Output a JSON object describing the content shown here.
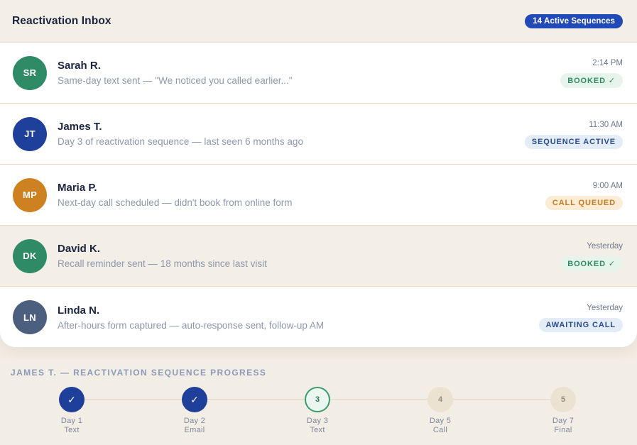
{
  "inbox": {
    "title": "Reactivation Inbox",
    "badge": "14 Active Sequences",
    "rows": [
      {
        "initials": "SR",
        "name": "Sarah R.",
        "desc": "Same-day text sent — \"We noticed you called earlier...\"",
        "time": "2:14 PM",
        "status": "BOOKED ✓",
        "avatar_color": "#2f8a66",
        "status_bg": "#e6f4ec",
        "status_color": "#2f8a5f",
        "highlight": false
      },
      {
        "initials": "JT",
        "name": "James T.",
        "desc": "Day 3 of reactivation sequence — last seen 6 months ago",
        "time": "11:30 AM",
        "status": "SEQUENCE ACTIVE",
        "avatar_color": "#1e3f9a",
        "status_bg": "#e4ecf8",
        "status_color": "#2a4c8f",
        "highlight": false
      },
      {
        "initials": "MP",
        "name": "Maria P.",
        "desc": "Next-day call scheduled — didn't book from online form",
        "time": "9:00 AM",
        "status": "CALL QUEUED",
        "avatar_color": "#cd8120",
        "status_bg": "#fbecd6",
        "status_color": "#c67a1f",
        "highlight": false
      },
      {
        "initials": "DK",
        "name": "David K.",
        "desc": "Recall reminder sent — 18 months since last visit",
        "time": "Yesterday",
        "status": "BOOKED ✓",
        "avatar_color": "#2f8a66",
        "status_bg": "#e6f4ec",
        "status_color": "#2f8a5f",
        "highlight": true
      },
      {
        "initials": "LN",
        "name": "Linda N.",
        "desc": "After-hours form captured — auto-response sent, follow-up AM",
        "time": "Yesterday",
        "status": "AWAITING CALL",
        "avatar_color": "#4d5f7e",
        "status_bg": "#e4ecf8",
        "status_color": "#2a4c8f",
        "highlight": false
      }
    ]
  },
  "progress": {
    "title": "JAMES T. — REACTIVATION SEQUENCE PROGRESS",
    "steps": [
      {
        "mark": "✓",
        "day": "Day 1",
        "label": "Text",
        "state": "done"
      },
      {
        "mark": "✓",
        "day": "Day 2",
        "label": "Email",
        "state": "done"
      },
      {
        "mark": "3",
        "day": "Day 3",
        "label": "Text",
        "state": "current"
      },
      {
        "mark": "4",
        "day": "Day 5",
        "label": "Call",
        "state": "pending"
      },
      {
        "mark": "5",
        "day": "Day 7",
        "label": "Final",
        "state": "pending"
      }
    ]
  }
}
